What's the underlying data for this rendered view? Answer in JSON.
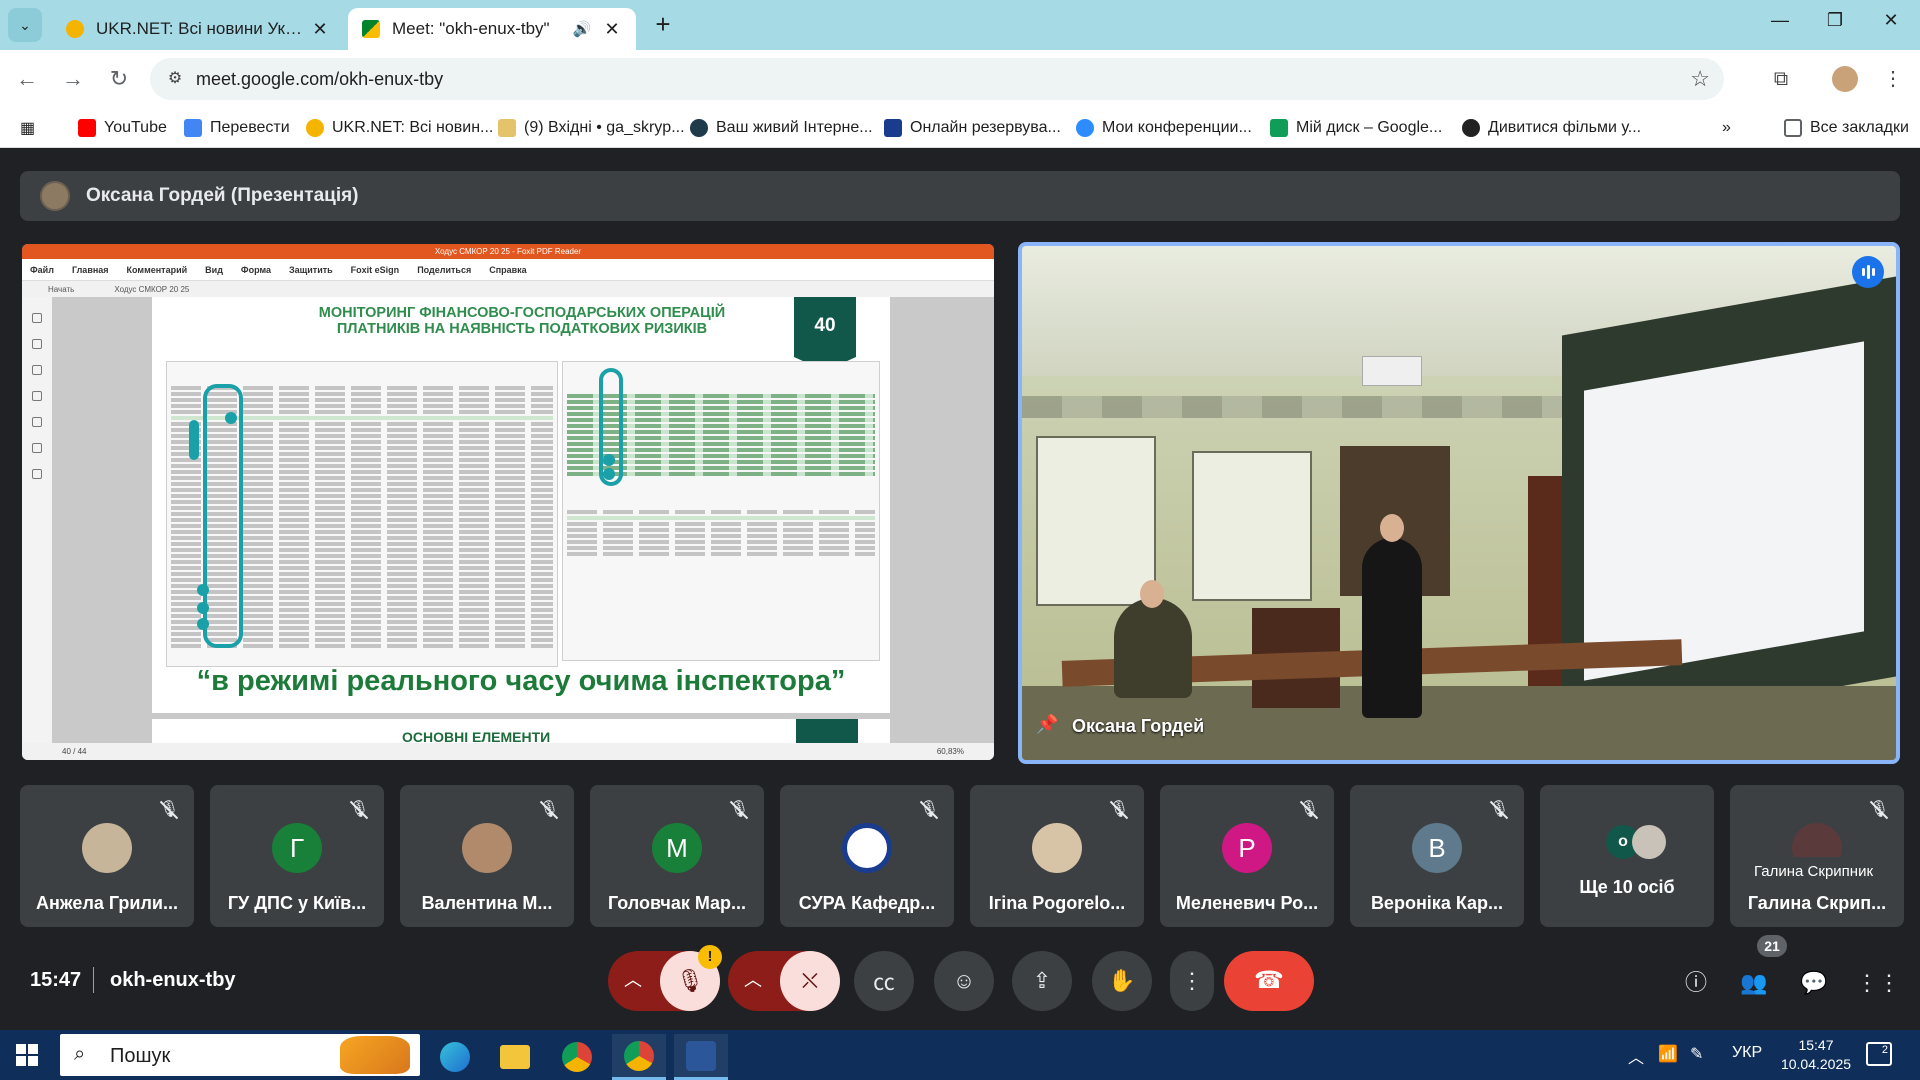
{
  "browser": {
    "tabs": [
      {
        "title": "UKR.NET: Всі новини України, о",
        "active": false
      },
      {
        "title": "Meet: \"okh-enux-tby\"",
        "active": true
      }
    ],
    "url": "meet.google.com/okh-enux-tby",
    "bookmarks": [
      {
        "label": "YouTube",
        "icon": "youtube-icon",
        "color": "#ff0000"
      },
      {
        "label": "Перевести",
        "icon": "translate-icon",
        "color": "#4285f4"
      },
      {
        "label": "UKR.NET: Всі новин...",
        "icon": "ukrnet-icon",
        "color": "#f4b400"
      },
      {
        "label": "(9) Вхідні • ga_skryp...",
        "icon": "mail-icon",
        "color": "#e4c46a"
      },
      {
        "label": "Ваш живий Інтерне...",
        "icon": "site-icon",
        "color": "#1f3a4a"
      },
      {
        "label": "Онлайн резервува...",
        "icon": "uz-icon",
        "color": "#1a3c8f"
      },
      {
        "label": "Мои конференции...",
        "icon": "zoom-icon",
        "color": "#2d8cff"
      },
      {
        "label": "Мій диск – Google...",
        "icon": "drive-icon",
        "color": "#0f9d58"
      },
      {
        "label": "Дивитися фільми у...",
        "icon": "film-icon",
        "color": "#222222"
      }
    ],
    "all_bookmarks": "Все закладки"
  },
  "meet": {
    "presentation_title": "Оксана Гордей (Презентація)",
    "pdf": {
      "window_title": "Ходус СМКОР 20 25 - Foxit PDF Reader",
      "menu": [
        "Файл",
        "Главная",
        "Комментарий",
        "Вид",
        "Форма",
        "Защитить",
        "Foxit eSign",
        "Поделиться",
        "Справка"
      ],
      "tabs": [
        "Начать",
        "Ходус СМКОР 20 25"
      ],
      "heading": "МОНІТОРИНГ ФІНАНСОВО-ГОСПОДАРСЬКИХ ОПЕРАЦІЙ ПЛАТНИКІВ НА НАЯВНІСТЬ ПОДАТКОВИХ РИЗИКІВ",
      "page_badge": "40",
      "slogan": "“в режимі реального часу очима інспектора”",
      "next_page_title": "ОСНОВНІ ЕЛЕМЕНТИ",
      "page_indicator": "40 / 44",
      "zoom": "60,83%"
    },
    "camera": {
      "name": "Оксана Гордей"
    },
    "participants": [
      {
        "name": "Анжела Грили...",
        "avatar_type": "photo",
        "color": "#c7b59a"
      },
      {
        "name": "ГУ ДПС у Київ...",
        "avatar_type": "letter",
        "letter": "Г",
        "color": "#188038"
      },
      {
        "name": "Валентина М...",
        "avatar_type": "photo",
        "color": "#b08a6b"
      },
      {
        "name": "Головчак Мар...",
        "avatar_type": "letter",
        "letter": "М",
        "color": "#188038"
      },
      {
        "name": "СУРА Кафедр...",
        "avatar_type": "logo",
        "color": "#1a3c8f"
      },
      {
        "name": "Iгina Pogorelo...",
        "avatar_type": "photo",
        "color": "#d7c3a5"
      },
      {
        "name": "Меленевич Ро...",
        "avatar_type": "letter",
        "letter": "Р",
        "color": "#d01884"
      },
      {
        "name": "Вероніка Кар...",
        "avatar_type": "letter",
        "letter": "В",
        "color": "#5f7a8c"
      },
      {
        "name": "Ще 10 осіб",
        "avatar_type": "more",
        "letter": "о",
        "color": "#12584a"
      },
      {
        "name": "Галина Скрип...",
        "avatar_type": "photo",
        "color": "#5a3a3a"
      }
    ],
    "tooltip": "Галина Скрипник",
    "time": "15:47",
    "meeting_code": "okh-enux-tby",
    "people_count": "21",
    "warning": "!"
  },
  "taskbar": {
    "search_placeholder": "Пошук",
    "language": "УКР",
    "time": "15:47",
    "date": "10.04.2025",
    "notification_count": "2"
  }
}
